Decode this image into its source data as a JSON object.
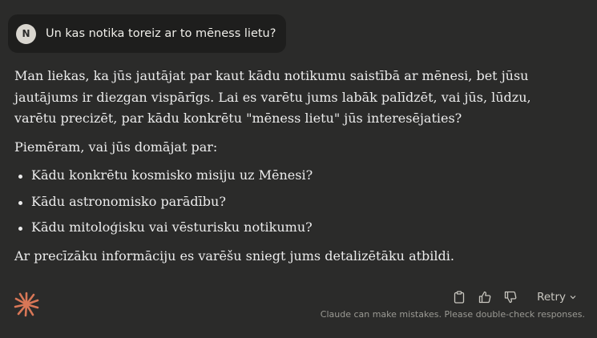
{
  "user_message": {
    "avatar_initial": "N",
    "text": "Un kas notika toreiz ar to mēness lietu?"
  },
  "assistant_reply": {
    "paragraph_1": "Man liekas, ka jūs jautājat par kaut kādu notikumu saistībā ar mēnesi, bet jūsu jautājums ir diezgan vispārīgs. Lai es varētu jums labāk palīdzēt, vai jūs, lūdzu, varētu precizēt, par kādu konkrētu \"mēness lietu\" jūs interesējaties?",
    "paragraph_2": "Piemēram, vai jūs domājat par:",
    "bullets": [
      "Kādu konkrētu kosmisko misiju uz Mēnesi?",
      "Kādu astronomisko parādību?",
      "Kādu mitoloģisku vai vēsturisku notikumu?"
    ],
    "paragraph_3": "Ar precīzāku informāciju es varēšu sniegt jums detalizētāku atbildi."
  },
  "actions": {
    "copy_icon": "clipboard-icon",
    "thumbs_up_icon": "thumbs-up-icon",
    "thumbs_down_icon": "thumbs-down-icon",
    "retry_label": "Retry"
  },
  "disclaimer": "Claude can make mistakes. Please double-check responses.",
  "colors": {
    "background": "#2b2b2a",
    "user_bubble": "#1e1e1d",
    "accent_star": "#d97757"
  }
}
